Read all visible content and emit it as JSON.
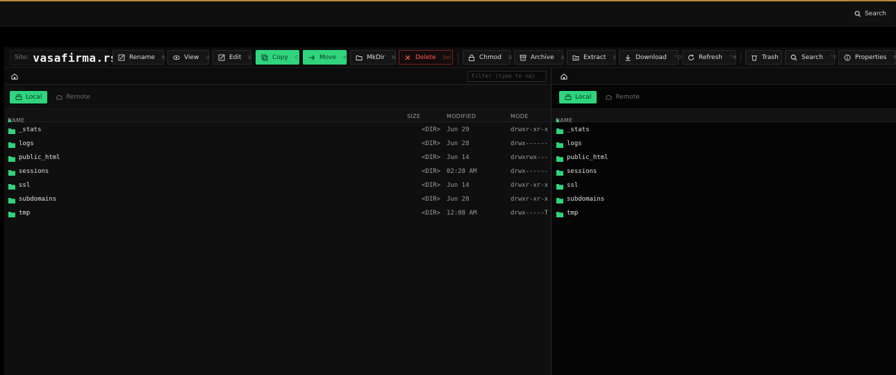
{
  "topbar": {
    "search_label": "Search"
  },
  "site": {
    "label": "Site:",
    "name": "vasafirma.rs"
  },
  "toolbar": {
    "rename": {
      "label": "Rename",
      "key": "R"
    },
    "view": {
      "label": "View",
      "key": "V"
    },
    "edit": {
      "label": "Edit",
      "key": "E"
    },
    "copy": {
      "label": "Copy",
      "key": "C"
    },
    "move": {
      "label": "Move",
      "key": "M"
    },
    "mkdir": {
      "label": "MkDir",
      "key": "N"
    },
    "delete": {
      "label": "Delete",
      "key": "Del"
    },
    "chmod": {
      "label": "Chmod",
      "key": "G"
    },
    "archive": {
      "label": "Archive",
      "key": "A"
    },
    "extract": {
      "label": "Extract",
      "key": "X"
    },
    "download": {
      "label": "Download",
      "key": "^D"
    },
    "refresh": {
      "label": "Refresh",
      "key": "^R"
    },
    "trash": {
      "label": "Trash"
    },
    "search": {
      "label": "Search",
      "key": "^F"
    },
    "properties": {
      "label": "Properties",
      "key": "P"
    }
  },
  "colors": {
    "accent": "#2fd47d",
    "danger": "#ff5a5a",
    "top_line": "#b8863b"
  },
  "left_pane": {
    "filter_placeholder": "Filter (type to na)",
    "tabs": {
      "local": "Local",
      "remote": "Remote"
    },
    "columns": {
      "name": "NAME",
      "size": "SIZE",
      "modified": "MODIFIED",
      "mode": "MODE"
    },
    "rows": [
      {
        "name": "_stats",
        "size": "<DIR>",
        "modified": "Jun 29",
        "mode": "drwxr-xr-x"
      },
      {
        "name": "logs",
        "size": "<DIR>",
        "modified": "Jun 28",
        "mode": "drwx------"
      },
      {
        "name": "public_html",
        "size": "<DIR>",
        "modified": "Jun 14",
        "mode": "drwxrwx---"
      },
      {
        "name": "sessions",
        "size": "<DIR>",
        "modified": "02:28 AM",
        "mode": "drwx------"
      },
      {
        "name": "ssl",
        "size": "<DIR>",
        "modified": "Jun 14",
        "mode": "drwxr-xr-x"
      },
      {
        "name": "subdomains",
        "size": "<DIR>",
        "modified": "Jun 28",
        "mode": "drwxr-xr-x"
      },
      {
        "name": "tmp",
        "size": "<DIR>",
        "modified": "12:08 AM",
        "mode": "drwx-----T"
      }
    ]
  },
  "right_pane": {
    "tabs": {
      "local": "Local",
      "remote": "Remote"
    },
    "columns": {
      "name": "NAME"
    },
    "rows": [
      {
        "name": "_stats"
      },
      {
        "name": "logs"
      },
      {
        "name": "public_html"
      },
      {
        "name": "sessions"
      },
      {
        "name": "ssl"
      },
      {
        "name": "subdomains"
      },
      {
        "name": "tmp"
      }
    ]
  }
}
